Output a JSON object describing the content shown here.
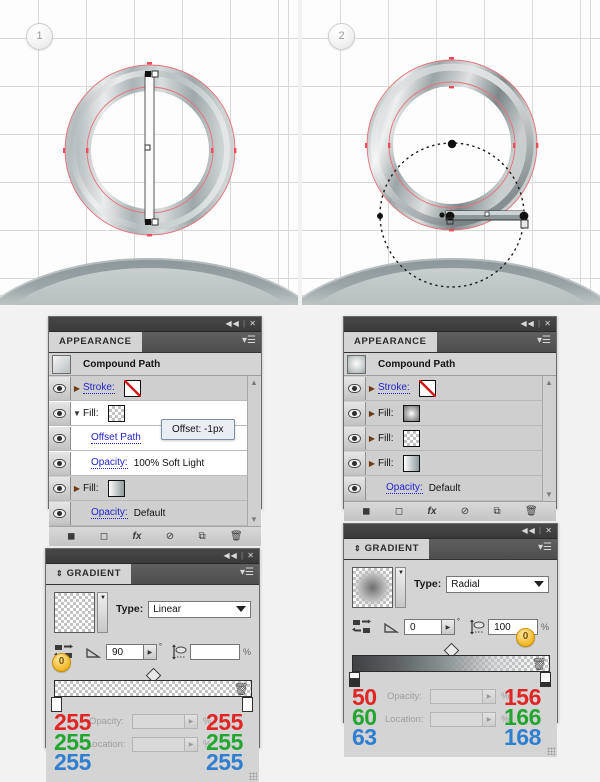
{
  "illustration": {
    "steps": [
      {
        "number": "1"
      },
      {
        "number": "2"
      }
    ]
  },
  "appearance_left": {
    "tab_label": "APPEARANCE",
    "object_title": "Compound Path",
    "titlebar": {
      "collapse": "◀◀",
      "separator": "|",
      "close": "✕"
    },
    "rows": [
      {
        "label": "Stroke:",
        "value": "",
        "swatch": "none"
      },
      {
        "label": "Fill:",
        "value": "",
        "swatch": "checker"
      },
      {
        "label": "Offset Path",
        "value": "",
        "swatch": ""
      },
      {
        "label": "Opacity:",
        "value": "100% Soft Light",
        "swatch": ""
      },
      {
        "label": "Fill:",
        "value": "",
        "swatch": "gradient-linear"
      },
      {
        "label": "Opacity:",
        "value": "Default",
        "swatch": ""
      }
    ],
    "tooltip": "Offset: -1px",
    "footer_icons": [
      "add-new-stroke-icon",
      "add-new-fill-icon",
      "add-effect-icon",
      "clear-appearance-icon",
      "duplicate-item-icon",
      "delete-item-icon"
    ]
  },
  "appearance_right": {
    "tab_label": "APPEARANCE",
    "object_title": "Compound Path",
    "titlebar": {
      "collapse": "◀◀",
      "separator": "|",
      "close": "✕"
    },
    "rows": [
      {
        "label": "Stroke:",
        "value": "",
        "swatch": "none"
      },
      {
        "label": "Fill:",
        "value": "",
        "swatch": "gradient-radial"
      },
      {
        "label": "Fill:",
        "value": "",
        "swatch": "checker"
      },
      {
        "label": "Fill:",
        "value": "",
        "swatch": "gradient-linear"
      },
      {
        "label": "Opacity:",
        "value": "Default",
        "swatch": ""
      }
    ],
    "footer_icons": [
      "add-new-stroke-icon",
      "add-new-fill-icon",
      "add-effect-icon",
      "clear-appearance-icon",
      "duplicate-item-icon",
      "delete-item-icon"
    ]
  },
  "gradient_left": {
    "tab_label": "GRADIENT",
    "type_label": "Type:",
    "type_value": "Linear",
    "angle_value": "90",
    "angle_unit": "°",
    "aspect_value": "",
    "aspect_unit": "%",
    "badge": "0",
    "opacity_label": "Opacity:",
    "opacity_value": "",
    "opacity_unit": "%",
    "location_label": "Location:",
    "location_value": "",
    "location_unit": "%",
    "left_stop_rgb": {
      "r": "255",
      "g": "255",
      "b": "255"
    },
    "right_stop_rgb": {
      "r": "255",
      "g": "255",
      "b": "255"
    },
    "colors": {
      "r": "#e02525",
      "g": "#22a531",
      "b": "#2f7fd0",
      "accent_badge": "#f0b723"
    }
  },
  "gradient_right": {
    "tab_label": "GRADIENT",
    "type_label": "Type:",
    "type_value": "Radial",
    "angle_value": "0",
    "angle_unit": "°",
    "aspect_value": "100",
    "aspect_unit": "%",
    "badge": "0",
    "opacity_label": "Opacity:",
    "opacity_value": "",
    "opacity_unit": "%",
    "location_label": "Location:",
    "location_value": "",
    "location_unit": "%",
    "left_stop_rgb": {
      "r": "50",
      "g": "60",
      "b": "63"
    },
    "right_stop_rgb": {
      "r": "156",
      "g": "166",
      "b": "168"
    },
    "colors": {
      "r": "#e02525",
      "g": "#22a531",
      "b": "#2f7fd0",
      "accent_badge": "#f0b723"
    }
  }
}
